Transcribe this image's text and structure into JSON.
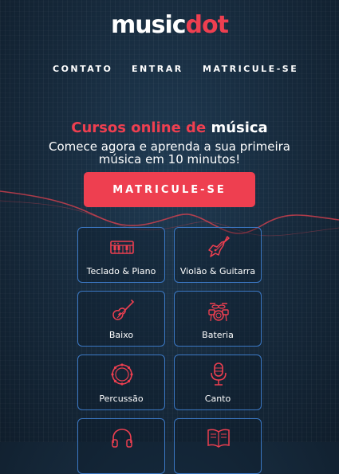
{
  "brand": {
    "part1": "music",
    "part2": "dot"
  },
  "nav": [
    {
      "label": "CONTATO"
    },
    {
      "label": "ENTRAR"
    },
    {
      "label": "MATRICULE-SE"
    }
  ],
  "hero": {
    "title_red": "Cursos online de",
    "title_white": "música",
    "subtitle": "Comece agora e aprenda a sua primeira música em 10 minutos!",
    "cta_label": "MATRICULE-SE"
  },
  "courses": [
    {
      "label": "Teclado & Piano",
      "icon": "piano-keyboard-icon"
    },
    {
      "label": "Violão & Guitarra",
      "icon": "guitar-icon"
    },
    {
      "label": "Baixo",
      "icon": "bass-guitar-icon"
    },
    {
      "label": "Bateria",
      "icon": "drum-kit-icon"
    },
    {
      "label": "Percussão",
      "icon": "tambourine-icon"
    },
    {
      "label": "Canto",
      "icon": "microphone-icon"
    },
    {
      "label": "",
      "icon": "headphones-icon"
    },
    {
      "label": "",
      "icon": "songbook-icon"
    }
  ],
  "colors": {
    "accent": "#ee3f50",
    "card_border": "#3b78c4",
    "background": "#1b3247"
  }
}
